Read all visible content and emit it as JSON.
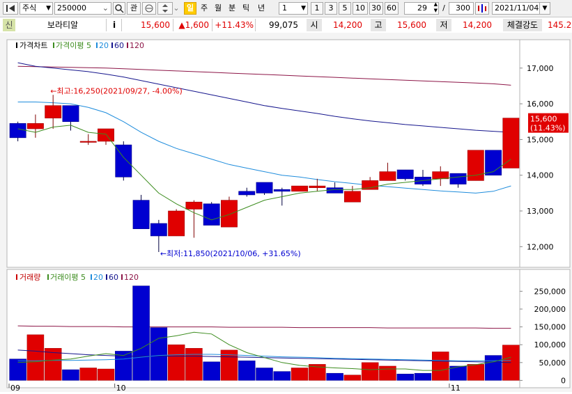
{
  "toolbar": {
    "market": "주식",
    "code": "250000",
    "btn_gwan": "관",
    "periods": [
      "일",
      "주",
      "월",
      "분",
      "틱",
      "년"
    ],
    "active_period": "일",
    "interval_value": "1",
    "minute_options": [
      "1",
      "3",
      "5",
      "10",
      "30",
      "60"
    ],
    "count_value": "29",
    "separator": "/",
    "total_value": "300",
    "date_value": "2021/11/04"
  },
  "info": {
    "badge": "신",
    "name": "보라티알",
    "info_button": "i",
    "price": "15,600",
    "change": "▲1,600",
    "change_pct": "+11.43%",
    "volume": "99,075",
    "open_label": "시",
    "open": "14,200",
    "high_label": "고",
    "high": "15,600",
    "low_label": "저",
    "low": "14,200",
    "strength_label": "체결강도",
    "strength": "145.2"
  },
  "colors": {
    "up": "#e00000",
    "down": "#0000d0",
    "ma5": "#3c8c1e",
    "ma20": "#1e8cdc",
    "ma60": "#14148c",
    "ma120": "#8c1446"
  },
  "chart_data": [
    {
      "type": "candlestick",
      "title": "가격차트",
      "legend": [
        {
          "label": "가격이평",
          "value": "5",
          "color": "#3c8c1e"
        },
        {
          "label": "",
          "value": "20",
          "color": "#1e8cdc"
        },
        {
          "label": "",
          "value": "60",
          "color": "#14148c"
        },
        {
          "label": "",
          "value": "120",
          "color": "#8c1446"
        }
      ],
      "ylim": [
        11500,
        17600
      ],
      "y_ticks": [
        12000,
        13000,
        14000,
        15000,
        16000,
        17000
      ],
      "y_tick_labels": [
        "12,000",
        "13,000",
        "14,000",
        "15,000",
        "16,000",
        "17,000"
      ],
      "last_price_label": "15,600",
      "last_pct_label": "(11.43%)",
      "annotations": {
        "high": "←최고:16,250(2021/09/27, -4.00%)",
        "low": "←최저:11,850(2021/10/06, +31.65%)"
      },
      "candles": [
        {
          "o": 15450,
          "h": 15500,
          "l": 14950,
          "c": 15050
        },
        {
          "o": 15300,
          "h": 15700,
          "l": 15050,
          "c": 15450
        },
        {
          "o": 15600,
          "h": 16250,
          "l": 15300,
          "c": 15950
        },
        {
          "o": 15950,
          "h": 15950,
          "l": 15250,
          "c": 15500
        },
        {
          "o": 14950,
          "h": 15150,
          "l": 14850,
          "c": 14950
        },
        {
          "o": 14950,
          "h": 15200,
          "l": 14850,
          "c": 15300
        },
        {
          "o": 14850,
          "h": 14950,
          "l": 13850,
          "c": 13950
        },
        {
          "o": 13300,
          "h": 13450,
          "l": 12500,
          "c": 12500
        },
        {
          "o": 12650,
          "h": 12750,
          "l": 11850,
          "c": 12300
        },
        {
          "o": 12300,
          "h": 13050,
          "l": 12300,
          "c": 13000
        },
        {
          "o": 13050,
          "h": 13300,
          "l": 12250,
          "c": 13250
        },
        {
          "o": 13200,
          "h": 13250,
          "l": 12600,
          "c": 12600
        },
        {
          "o": 12550,
          "h": 13400,
          "l": 12550,
          "c": 13300
        },
        {
          "o": 13550,
          "h": 13650,
          "l": 13400,
          "c": 13450
        },
        {
          "o": 13800,
          "h": 13800,
          "l": 13450,
          "c": 13500
        },
        {
          "o": 13600,
          "h": 13650,
          "l": 13150,
          "c": 13550
        },
        {
          "o": 13550,
          "h": 13650,
          "l": 13550,
          "c": 13700
        },
        {
          "o": 13650,
          "h": 13900,
          "l": 13550,
          "c": 13700
        },
        {
          "o": 13650,
          "h": 13800,
          "l": 13550,
          "c": 13500
        },
        {
          "o": 13250,
          "h": 13700,
          "l": 13250,
          "c": 13550
        },
        {
          "o": 13600,
          "h": 13950,
          "l": 13600,
          "c": 13850
        },
        {
          "o": 13850,
          "h": 14350,
          "l": 13850,
          "c": 14100
        },
        {
          "o": 14150,
          "h": 14150,
          "l": 13850,
          "c": 13900
        },
        {
          "o": 13950,
          "h": 14150,
          "l": 13700,
          "c": 13750
        },
        {
          "o": 13900,
          "h": 14250,
          "l": 13700,
          "c": 14100
        },
        {
          "o": 14050,
          "h": 14050,
          "l": 13650,
          "c": 13750
        },
        {
          "o": 13850,
          "h": 14700,
          "l": 13850,
          "c": 14700
        },
        {
          "o": 14700,
          "h": 14700,
          "l": 14000,
          "c": 14000
        },
        {
          "o": 14200,
          "h": 15600,
          "l": 14200,
          "c": 15600
        }
      ],
      "ma5": [
        15300,
        15200,
        15350,
        15400,
        15200,
        15150,
        14500,
        14000,
        13500,
        13200,
        12950,
        12750,
        12900,
        13100,
        13300,
        13400,
        13500,
        13550,
        13600,
        13600,
        13650,
        13750,
        13800,
        13850,
        13900,
        13950,
        14000,
        14100,
        14450
      ],
      "ma20": [
        16050,
        16050,
        16030,
        16000,
        15900,
        15750,
        15500,
        15200,
        14950,
        14750,
        14600,
        14450,
        14300,
        14200,
        14100,
        14000,
        13950,
        13880,
        13820,
        13770,
        13720,
        13680,
        13640,
        13600,
        13560,
        13530,
        13500,
        13550,
        13700
      ],
      "ma60": [
        17150,
        17050,
        17000,
        16950,
        16900,
        16830,
        16750,
        16650,
        16550,
        16450,
        16350,
        16250,
        16150,
        16050,
        15950,
        15870,
        15800,
        15730,
        15650,
        15580,
        15520,
        15470,
        15420,
        15380,
        15340,
        15300,
        15260,
        15230,
        15200
      ],
      "ma120": [
        17050,
        17040,
        17030,
        17020,
        17010,
        17000,
        16980,
        16960,
        16940,
        16920,
        16900,
        16880,
        16860,
        16840,
        16820,
        16800,
        16780,
        16760,
        16740,
        16720,
        16700,
        16680,
        16660,
        16640,
        16620,
        16600,
        16580,
        16560,
        16520
      ]
    },
    {
      "type": "bar",
      "title": "거래량",
      "legend": [
        {
          "label": "거래이평",
          "value": "5",
          "color": "#3c8c1e"
        },
        {
          "label": "",
          "value": "20",
          "color": "#1e8cdc"
        },
        {
          "label": "",
          "value": "60",
          "color": "#14148c"
        },
        {
          "label": "",
          "value": "120",
          "color": "#8c1446"
        }
      ],
      "ylim": [
        -5000,
        280000
      ],
      "y_ticks": [
        0,
        50000,
        100000,
        150000,
        200000,
        250000
      ],
      "y_tick_labels": [
        "0",
        "50,000",
        "100,000",
        "150,000",
        "200,000",
        "250,000"
      ],
      "x_labels": [
        {
          "index": 0,
          "label": "09"
        },
        {
          "index": 6,
          "label": "10"
        },
        {
          "index": 25,
          "label": "11"
        }
      ],
      "volumes": [
        60000,
        128000,
        90000,
        30000,
        35000,
        32000,
        82000,
        265000,
        148000,
        100000,
        90000,
        52000,
        85000,
        55000,
        35000,
        25000,
        35000,
        45000,
        20000,
        15000,
        50000,
        40000,
        18000,
        20000,
        80000,
        40000,
        45000,
        70000,
        99075
      ],
      "vol_ma5": [
        50000,
        52000,
        57000,
        60000,
        68000,
        75000,
        70000,
        90000,
        118000,
        125000,
        135000,
        130000,
        100000,
        78000,
        64000,
        50000,
        42000,
        38000,
        35000,
        33000,
        30000,
        32000,
        32000,
        28000,
        28000,
        38000,
        44000,
        52000,
        65000
      ],
      "vol_ma20": [
        55000,
        55000,
        56000,
        56000,
        57000,
        58000,
        60000,
        65000,
        70000,
        72000,
        73000,
        73000,
        72000,
        70000,
        68000,
        66000,
        65000,
        64000,
        62000,
        61000,
        60000,
        59000,
        58000,
        57000,
        56000,
        55000,
        55000,
        55000,
        56000
      ],
      "vol_ma60": [
        85000,
        82000,
        78000,
        75000,
        72000,
        70000,
        68000,
        68000,
        68000,
        68000,
        68000,
        67000,
        66000,
        65000,
        64000,
        63000,
        62000,
        61000,
        60000,
        59000,
        58000,
        57000,
        56000,
        55000,
        54000,
        53000,
        52000,
        51000,
        50000
      ],
      "vol_ma120": [
        153000,
        152000,
        152000,
        151000,
        151000,
        151000,
        150000,
        150000,
        150000,
        150000,
        150000,
        150000,
        149000,
        149000,
        149000,
        149000,
        148000,
        148000,
        148000,
        148000,
        148000,
        147000,
        147000,
        147000,
        147000,
        147000,
        147000,
        146000,
        146000
      ]
    }
  ]
}
